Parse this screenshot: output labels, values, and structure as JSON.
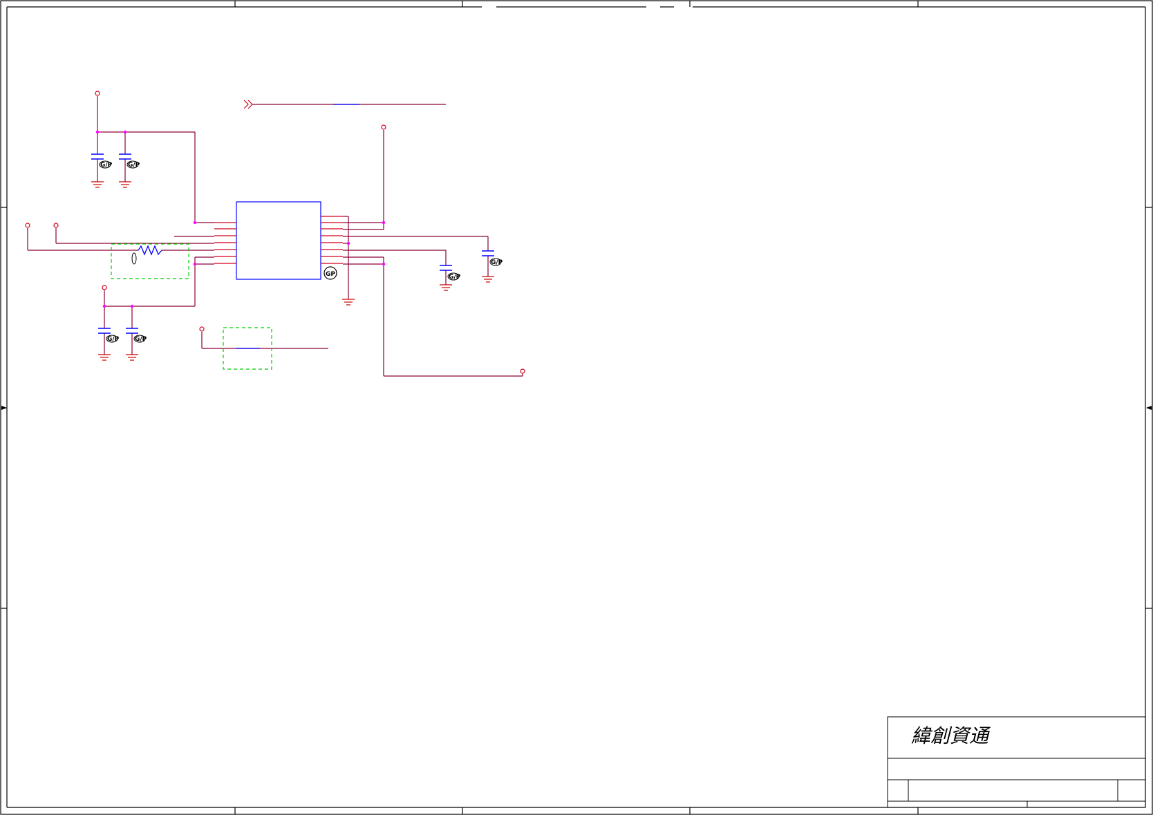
{
  "title_block": {
    "company_name": "緯創資通"
  },
  "symbols": {
    "green_part_mark": "GP",
    "green_part_small_mark": "G/P"
  },
  "colors": {
    "wire": "#8b0037",
    "pin_wire": "#d0001a",
    "component_body": "#0000ff",
    "junction": "#ff00ff",
    "dashed_box": "#00cc00",
    "ground": "#cc0000",
    "frame": "#000000"
  }
}
